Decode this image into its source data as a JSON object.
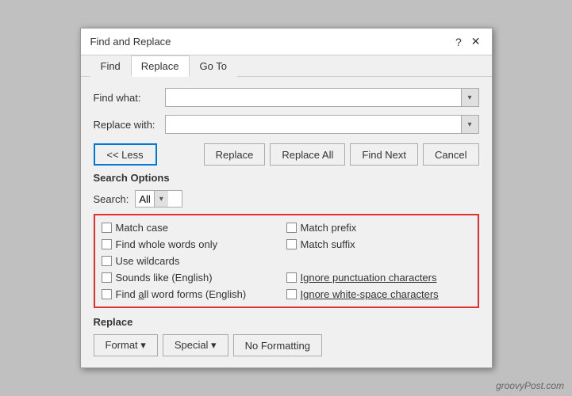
{
  "dialog": {
    "title": "Find and Replace",
    "help_btn": "?",
    "close_btn": "✕"
  },
  "tabs": [
    {
      "label": "Find",
      "underline": "F",
      "active": false
    },
    {
      "label": "Replace",
      "underline": "R",
      "active": true
    },
    {
      "label": "Go To",
      "underline": "G",
      "active": false
    }
  ],
  "find_what": {
    "label": "Find what:",
    "value": "",
    "placeholder": ""
  },
  "replace_with": {
    "label": "Replace with:",
    "value": "",
    "placeholder": ""
  },
  "buttons": {
    "less": "<< Less",
    "replace": "Replace",
    "replace_all": "Replace All",
    "find_next": "Find Next",
    "cancel": "Cancel"
  },
  "search_options": {
    "label": "Search Options",
    "search_label": "Search:",
    "search_value": "All"
  },
  "options": {
    "left_col": [
      {
        "id": "match-case",
        "label": "Match case",
        "underline": "M",
        "checked": false
      },
      {
        "id": "whole-words",
        "label": "Find whole words only",
        "underline": "o",
        "checked": false
      },
      {
        "id": "wildcards",
        "label": "Use wildcards",
        "underline": "U",
        "checked": false
      },
      {
        "id": "sounds-like",
        "label": "Sounds like (English)",
        "underline": "S",
        "checked": false
      },
      {
        "id": "word-forms",
        "label": "Find all word forms (English)",
        "underline": "a",
        "checked": false
      }
    ],
    "right_col": [
      {
        "id": "match-prefix",
        "label": "Match prefix",
        "underline": "x",
        "checked": false
      },
      {
        "id": "match-suffix",
        "label": "Match suffix",
        "underline": "t",
        "checked": false
      },
      {
        "id": "placeholder1",
        "label": "",
        "checked": false,
        "hidden": true
      },
      {
        "id": "ignore-punctuation",
        "label": "Ignore punctuation characters",
        "underline": "p",
        "checked": false
      },
      {
        "id": "ignore-whitespace",
        "label": "Ignore white-space characters",
        "underline": "w",
        "checked": false
      }
    ]
  },
  "replace_section": {
    "label": "Replace",
    "format_btn": "Format ▾",
    "special_btn": "Special ▾",
    "no_formatting_btn": "No Formatting"
  },
  "watermark": "groovyPost.com"
}
